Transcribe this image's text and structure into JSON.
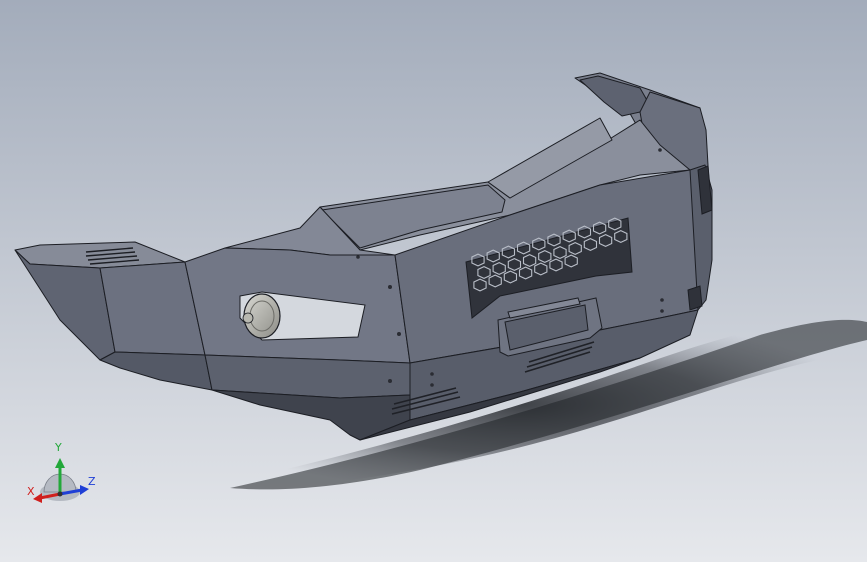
{
  "viewport": {
    "background_top": "#a3acbb",
    "background_bottom": "#e6e8ec",
    "model_fill": "#6d7280",
    "model_fill_light": "#7c8190",
    "model_fill_dark": "#555a66",
    "edge_color": "#1c1e24",
    "shadow_color": "#2a2d33"
  },
  "triad": {
    "x_label": "X",
    "y_label": "Y",
    "z_label": "Z",
    "x_color": "#d0201e",
    "y_color": "#22a83a",
    "z_color": "#1f3fd6"
  },
  "icons": {
    "fog_light": "fog-light-icon",
    "axis_triad": "axis-triad-icon"
  }
}
